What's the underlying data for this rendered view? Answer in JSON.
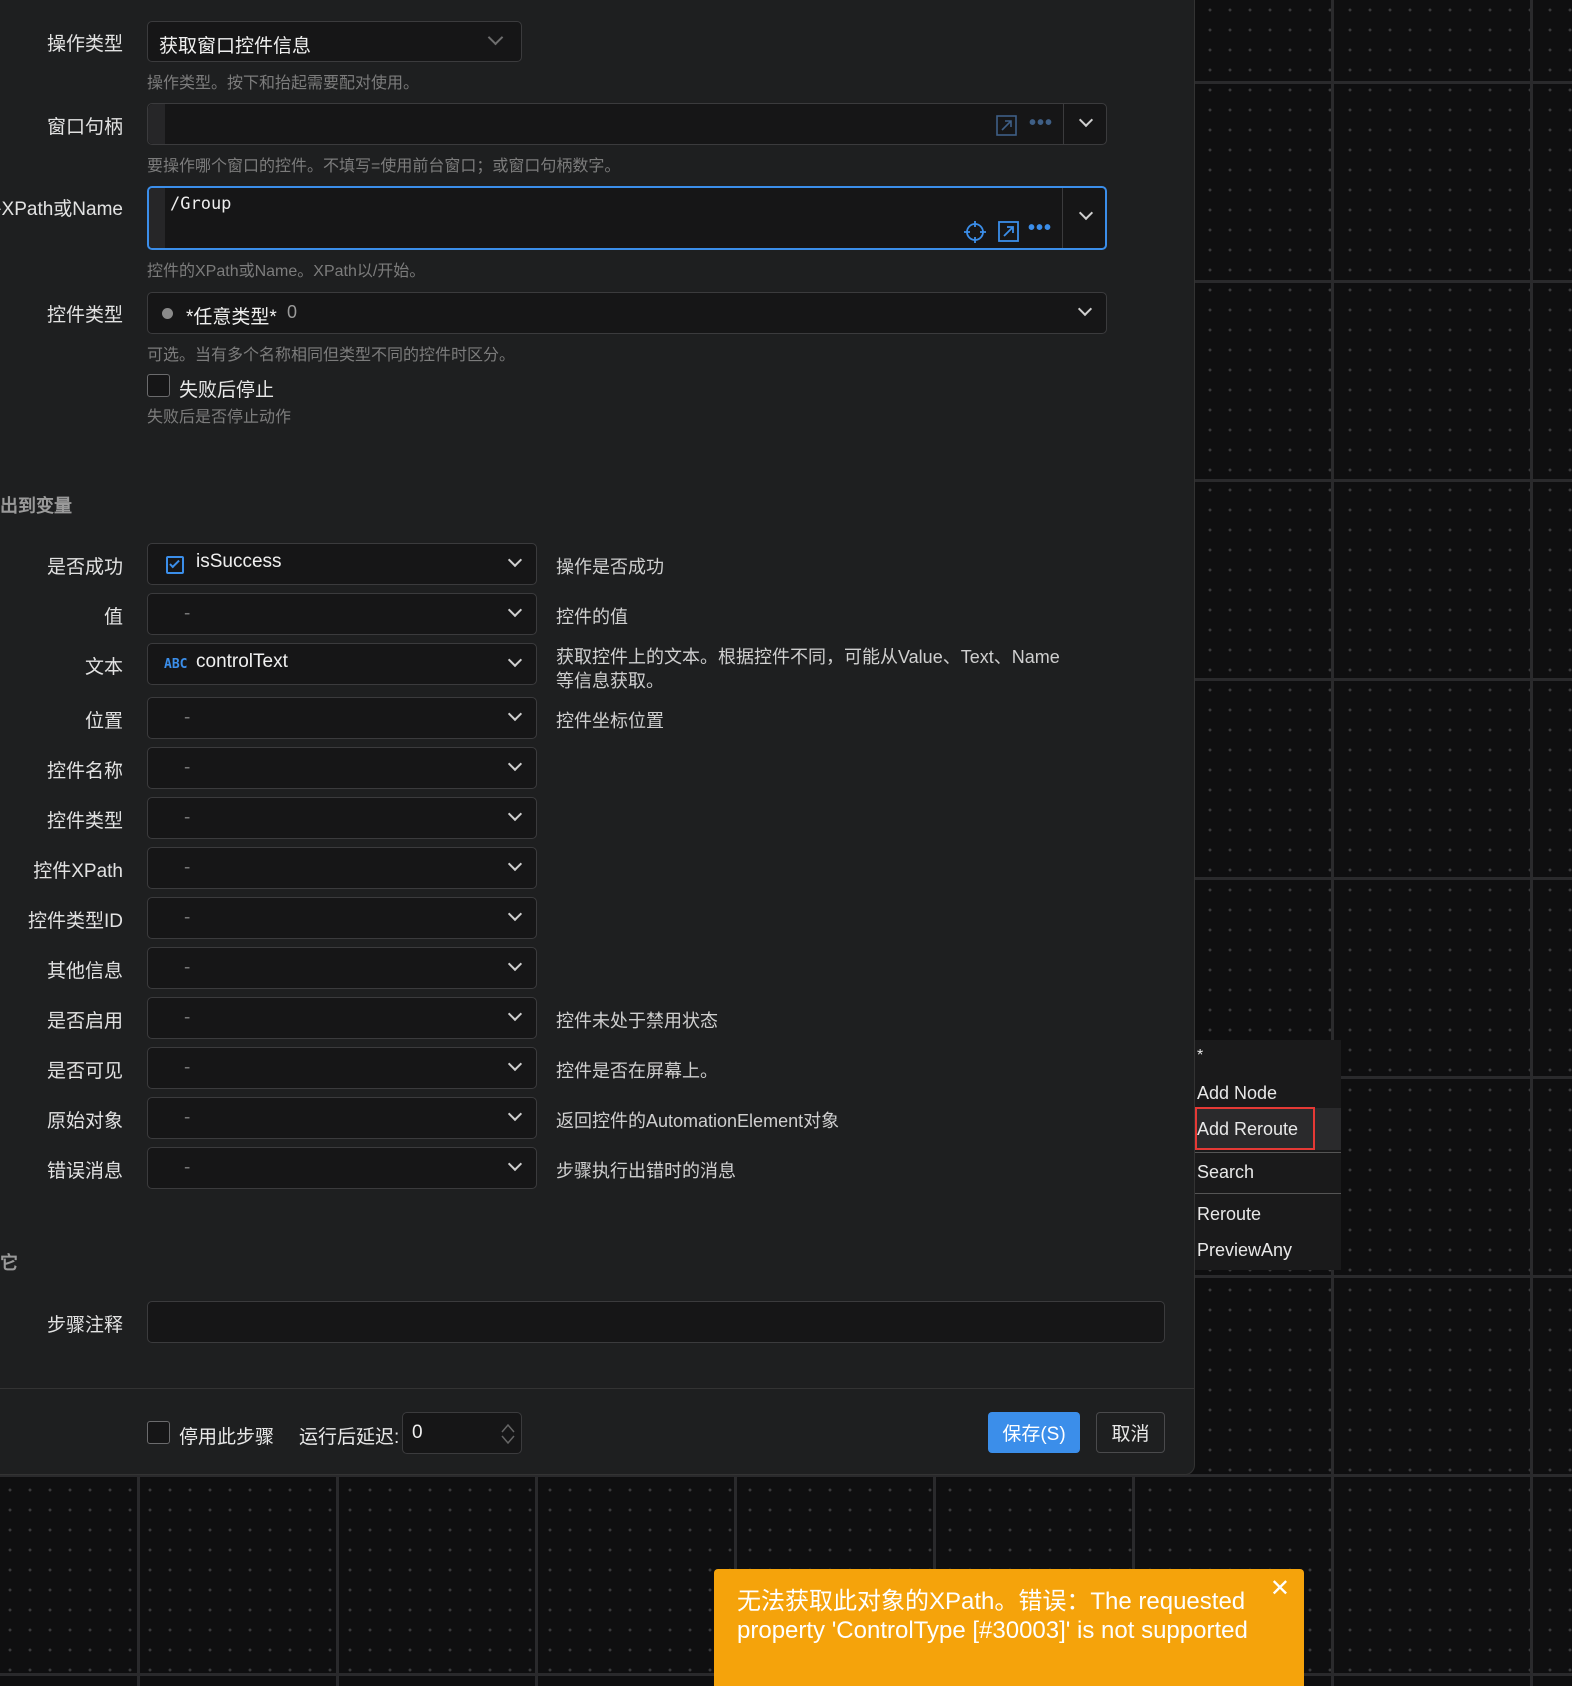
{
  "form": {
    "op_type": {
      "label": "操作类型",
      "value": "获取窗口控件信息",
      "hint": "操作类型。按下和抬起需要配对使用。"
    },
    "window_handle": {
      "label": "窗口句柄",
      "value": "",
      "hint": "要操作哪个窗口的控件。不填写=使用前台窗口；或窗口句柄数字。"
    },
    "xpath": {
      "label": "控件XPath或Name",
      "value": "/Group",
      "hint": "控件的XPath或Name。XPath以/开始。"
    },
    "control_type": {
      "label": "控件类型",
      "value": "*任意类型*",
      "count": "0",
      "hint": "可选。当有多个名称相同但类型不同的控件时区分。"
    },
    "stop_on_fail": {
      "label": "失败后停止",
      "hint": "失败后是否停止动作",
      "checked": false
    }
  },
  "output_section": {
    "title": "出到变量"
  },
  "outputs": [
    {
      "label": "是否成功",
      "value": "isSuccess",
      "icon": "checkbox-icon",
      "desc": "操作是否成功"
    },
    {
      "label": "值",
      "value": "-",
      "desc": "控件的值"
    },
    {
      "label": "文本",
      "value": "controlText",
      "icon": "abc-icon",
      "desc": "获取控件上的文本。根据控件不同，可能从Value、Text、Name",
      "desc2": "等信息获取。"
    },
    {
      "label": "位置",
      "value": "-",
      "desc": "控件坐标位置"
    },
    {
      "label": "控件名称",
      "value": "-",
      "desc": ""
    },
    {
      "label": "控件类型",
      "value": "-",
      "desc": ""
    },
    {
      "label": "控件XPath",
      "value": "-",
      "desc": ""
    },
    {
      "label": "控件类型ID",
      "value": "-",
      "desc": ""
    },
    {
      "label": "其他信息",
      "value": "-",
      "desc": ""
    },
    {
      "label": "是否启用",
      "value": "-",
      "desc": "控件未处于禁用状态"
    },
    {
      "label": "是否可见",
      "value": "-",
      "desc": "控件是否在屏幕上。"
    },
    {
      "label": "原始对象",
      "value": "-",
      "desc": "返回控件的AutomationElement对象"
    },
    {
      "label": "错误消息",
      "value": "-",
      "desc": "步骤执行出错时的消息"
    }
  ],
  "other_section": {
    "title": "它"
  },
  "step_comment": {
    "label": "步骤注释",
    "value": ""
  },
  "footer": {
    "disable_label": "停用此步骤",
    "delay_label": "运行后延迟:",
    "delay_value": "0",
    "save_label": "保存(S)",
    "cancel_label": "取消"
  },
  "context_menu": {
    "header": "*",
    "items": [
      "Add Node",
      "Add Reroute",
      "Search",
      "Reroute",
      "PreviewAny"
    ],
    "highlighted": "Add Reroute"
  },
  "toast": {
    "message": "无法获取此对象的XPath。错误：The requested property 'ControlType [#30003]' is not supported",
    "close_icon": "close-icon"
  },
  "colors": {
    "accent": "#3b8eea",
    "warning": "#f5a30b",
    "highlight_border": "#e53935"
  }
}
